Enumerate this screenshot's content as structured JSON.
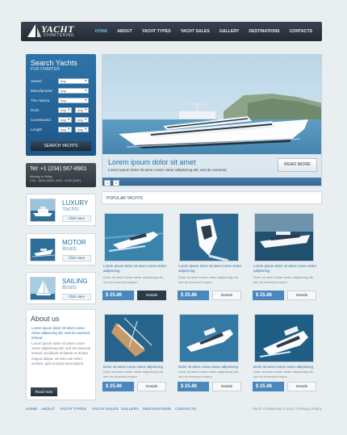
{
  "header": {
    "logo_word": "YACHT",
    "logo_sub": "CHARTERING",
    "nav": [
      "HOME",
      "ABOUT",
      "YACHT TYPES",
      "YACHT SALES",
      "GALLERY",
      "DESTINATIONS",
      "CONTACTS"
    ],
    "active_nav": "HOME"
  },
  "search": {
    "title": "Search Yachts",
    "subtitle": "FOR CHARTER",
    "fields": [
      {
        "label": "Vessel",
        "value": "Any"
      },
      {
        "label": "Manufacturer",
        "value": "Any"
      },
      {
        "label": "The marina",
        "value": "Any"
      },
      {
        "label": "Dock",
        "value": "Any",
        "extra": "Any"
      },
      {
        "label": "Constructed",
        "value": "Any",
        "extra": "Any"
      },
      {
        "label": "Length",
        "value": "Any",
        "extra": "Any"
      }
    ],
    "button": "SEARCH YACHTS"
  },
  "phone": {
    "number": "Tel: +1 (234) 567-8901",
    "hours": "Monday to Friday\n7:00 - 18:00 (GMT)  8:00 - 16:00 (GMT)"
  },
  "categories": [
    {
      "l1": "LUXURY",
      "l2": "Yachts",
      "button": "Click Here"
    },
    {
      "l1": "MOTOR",
      "l2": "Boats",
      "button": "Click Here"
    },
    {
      "l1": "SAILING",
      "l2": "Boats",
      "button": "Click Here"
    }
  ],
  "about": {
    "title": "About us",
    "lead": "Lorem ipsum dolor sit amet conse ctetur adipiscing elit, sed do eiusmod tempor.",
    "body": "Lorem ipsum dolor sit amet conse ctetur adipisicing elit, sed do eiusmod tempor incididunt ut labore et dolore magna aliqua. Ut enim ad minim veniam, quis nostrud exercitation.",
    "button": "Read more"
  },
  "slider": {
    "title": "Lorem ipsum dolor sit amet",
    "subtitle": "Lorem ipsum dolor sit amet conse ctetur adipisicing elit, sed do eiusmod",
    "button": "READ MORE",
    "pages": [
      "1",
      "2"
    ]
  },
  "popular": {
    "heading": "POPULAR YACHTS",
    "items": [
      {
        "title": "Lorem ipsum dolor sit amet conse ctetur adipisicing",
        "desc": "Dolor sit amet conse ctetur adipisicing elit, sed do eiusmod tempor.",
        "price": "$ 25.86",
        "button": "Details"
      },
      {
        "title": "Lorem ipsum dolor sit amet conse ctetur adipisicing",
        "desc": "Dolor sit amet conse ctetur adipisicing elit, sed do eiusmod tempor.",
        "price": "$ 25.86",
        "button": "Details"
      },
      {
        "title": "Lorem ipsum dolor sit amet conse ctetur adipisicing",
        "desc": "Dolor sit amet conse ctetur adipisicing elit, sed do eiusmod tempor.",
        "price": "$ 25.86",
        "button": "Details"
      },
      {
        "title": "Dolor sit amet conse ctetur adipisicing",
        "desc": "Dolor sit amet conse ctetur adipisicing elit, sed do eiusmod tempor.",
        "price": "$ 25.86",
        "button": "Details"
      },
      {
        "title": "Dolor sit amet conse ctetur adipisicing",
        "desc": "Dolor sit amet conse ctetur adipisicing elit, sed do eiusmod tempor.",
        "price": "$ 25.86",
        "button": "Details"
      },
      {
        "title": "Dolor sit amet conse ctetur adipisicing",
        "desc": "Dolor sit amet conse ctetur adipisicing elit, sed do eiusmod tempor.",
        "price": "$ 25.86",
        "button": "Details"
      }
    ]
  },
  "footer": {
    "links": [
      "HOME",
      "ABOUT",
      "YACHT TYPES",
      "YACHT SALES",
      "GALLERY",
      "DESTINATIONS",
      "CONTACTS"
    ],
    "copyright": "Yacht Chartering © 2012 | Privacy Policy"
  },
  "colors": {
    "accent": "#2f74a8",
    "header": "#2b333b",
    "background": "#e9eef1"
  }
}
